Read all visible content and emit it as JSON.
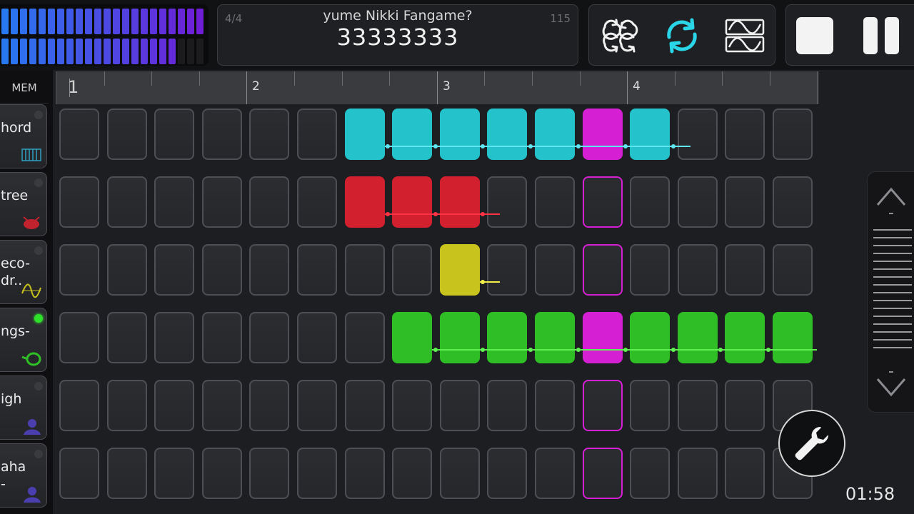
{
  "header": {
    "time_signature": "4/4",
    "tempo": "115",
    "song_title": "yume Nikki Fangame?",
    "song_code": "33333333"
  },
  "toolbar": {
    "buttons": [
      {
        "name": "pattern-icon"
      },
      {
        "name": "loop-icon"
      },
      {
        "name": "waveform-icon"
      }
    ],
    "accent_color": "#2ad5e8"
  },
  "sidebar": {
    "mem_label": "MEM",
    "tracks": [
      {
        "label": "hord",
        "icon": "keyboard-icon",
        "led": false
      },
      {
        "label": "tree",
        "icon": "drum-icon",
        "led": false
      },
      {
        "label": "eco-\ndr..",
        "icon": "wave-icon",
        "led": false
      },
      {
        "label": "ngs-",
        "icon": "horn-icon",
        "led": true
      },
      {
        "label": "igh",
        "icon": "singer-icon",
        "led": false
      },
      {
        "label": "aha\n-",
        "icon": "singer-icon",
        "led": false
      }
    ]
  },
  "ruler": {
    "beats": [
      "1",
      "2",
      "3",
      "4"
    ]
  },
  "sequencer": {
    "columns": 16,
    "playhead_column": 11,
    "rows": [
      {
        "color": "#24c3cc",
        "notes": [
          6,
          7,
          8,
          9,
          10,
          12
        ],
        "accent_cols": [
          11
        ],
        "tie_end": 13
      },
      {
        "color": "#d2202f",
        "notes": [
          6,
          7,
          8
        ],
        "accent_cols": [],
        "tie_end": 9
      },
      {
        "color": "#c9c41d",
        "notes": [
          8
        ],
        "accent_cols": [],
        "tie_end": 9
      },
      {
        "color": "#2fbe25",
        "notes": [
          7,
          8,
          9,
          10,
          12,
          13,
          14,
          15
        ],
        "accent_cols": [
          11
        ],
        "tie_end": 16
      },
      {
        "color": "#888888",
        "notes": [],
        "accent_cols": [],
        "tie_end": -1
      },
      {
        "color": "#888888",
        "notes": [],
        "accent_cols": [],
        "tie_end": -1
      }
    ],
    "accent_color": "#d41fd3"
  },
  "status": {
    "clock": "01:58"
  }
}
